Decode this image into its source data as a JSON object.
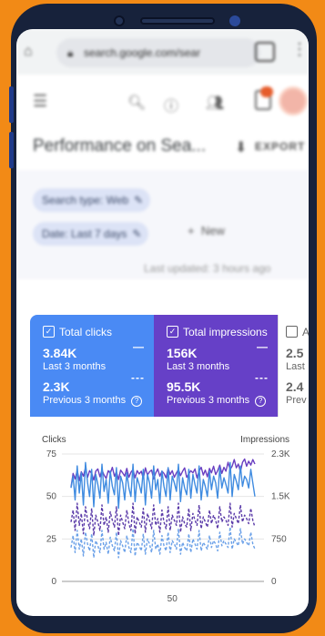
{
  "browser": {
    "url": "search.google.com/sear",
    "tab_count": ""
  },
  "page": {
    "title": "Performance on Sea...",
    "export_label": "EXPORT"
  },
  "filters": {
    "search_type": "Search type: Web",
    "date": "Date: Last 7 days",
    "new_label": "New",
    "last_updated": "Last updated: 3 hours ago"
  },
  "metrics": [
    {
      "label": "Total clicks",
      "current_value": "3.84K",
      "current_period": "Last 3 months",
      "previous_value": "2.3K",
      "previous_period": "Previous 3 months",
      "color": "#4a8af4"
    },
    {
      "label": "Total impressions",
      "current_value": "156K",
      "current_period": "Last 3 months",
      "previous_value": "95.5K",
      "previous_period": "Previous 3 months",
      "color": "#6640c7"
    },
    {
      "label": "A",
      "current_value": "2.5",
      "current_period": "Last",
      "previous_value": "2.4",
      "previous_period": "Prev"
    }
  ],
  "chart_data": {
    "type": "line",
    "ylabel_left": "Clicks",
    "ylabel_right": "Impressions",
    "y_left_ticks": [
      "75",
      "50",
      "25",
      "0"
    ],
    "y_right_ticks": [
      "2.3K",
      "1.5K",
      "750",
      "0"
    ],
    "ylim_left": [
      0,
      75
    ],
    "ylim_right": [
      0,
      2300
    ],
    "x_ticks": [
      "50"
    ],
    "xlim": [
      1,
      90
    ],
    "series": [
      {
        "axis": "right",
        "style": "solid",
        "color": "#6a3fc1",
        "values": [
          1700,
          1950,
          1850,
          2000,
          1820,
          1980,
          1900,
          2050,
          1880,
          2000,
          1950,
          1830,
          1990,
          2030,
          1890,
          2010,
          1920,
          1860,
          2000,
          1950,
          2060,
          1900,
          1980,
          1840,
          2010,
          1960,
          1900,
          2040,
          1880,
          1970,
          2020,
          1870,
          2000,
          1940,
          1990,
          1860,
          2050,
          1920,
          1980,
          2010,
          1850,
          1960,
          2030,
          1900,
          1990,
          1950,
          1870,
          2040,
          1930,
          2000,
          1880,
          1960,
          2020,
          1910,
          1990,
          2050,
          1880,
          1940,
          2000,
          1960,
          2030,
          1870,
          1990,
          2060,
          1920,
          2010,
          1890,
          2040,
          1960,
          2080,
          1930,
          2000,
          2100,
          1950,
          2060,
          1990,
          2150,
          2020,
          2080,
          2200,
          2050,
          2120,
          1980,
          2150,
          2210,
          2080,
          2170,
          2100,
          2200,
          2120
        ]
      },
      {
        "axis": "left",
        "style": "solid",
        "color": "#3f8be0",
        "values": [
          55,
          62,
          48,
          68,
          52,
          64,
          45,
          70,
          58,
          50,
          66,
          44,
          63,
          57,
          49,
          69,
          53,
          60,
          46,
          65,
          56,
          51,
          67,
          43,
          62,
          58,
          48,
          64,
          55,
          50,
          69,
          47,
          61,
          57,
          52,
          66,
          45,
          63,
          58,
          49,
          68,
          54,
          60,
          46,
          65,
          56,
          50,
          67,
          48,
          62,
          58,
          53,
          69,
          47,
          61,
          55,
          51,
          66,
          49,
          63,
          57,
          52,
          68,
          48,
          60,
          56,
          50,
          65,
          54,
          62,
          58,
          49,
          67,
          55,
          61,
          57,
          52,
          70,
          50,
          63,
          59,
          54,
          68,
          56,
          62,
          60,
          55,
          66,
          58,
          50
        ]
      },
      {
        "axis": "left",
        "style": "dashed",
        "color": "#5a3aa8",
        "values": [
          35,
          42,
          30,
          46,
          33,
          40,
          28,
          44,
          36,
          31,
          43,
          27,
          39,
          35,
          30,
          45,
          33,
          38,
          29,
          41,
          36,
          32,
          44,
          27,
          39,
          35,
          31,
          42,
          34,
          30,
          46,
          28,
          38,
          35,
          32,
          43,
          29,
          40,
          36,
          31,
          45,
          33,
          37,
          29,
          42,
          35,
          31,
          44,
          30,
          39,
          36,
          33,
          46,
          29,
          38,
          34,
          32,
          43,
          30,
          40,
          36,
          33,
          45,
          31,
          38,
          35,
          32,
          42,
          34,
          39,
          36,
          31,
          44,
          35,
          38,
          36,
          33,
          46,
          32,
          40,
          37,
          34,
          45,
          35,
          39,
          37,
          34,
          43,
          36,
          32
        ]
      },
      {
        "axis": "left",
        "style": "dashed",
        "color": "#6aa0e8",
        "values": [
          20,
          27,
          17,
          30,
          19,
          25,
          15,
          29,
          22,
          18,
          28,
          14,
          24,
          21,
          17,
          30,
          19,
          23,
          16,
          26,
          21,
          18,
          29,
          14,
          24,
          21,
          17,
          27,
          20,
          17,
          31,
          15,
          23,
          21,
          18,
          28,
          16,
          25,
          22,
          17,
          30,
          19,
          22,
          16,
          27,
          21,
          18,
          29,
          17,
          24,
          22,
          19,
          31,
          16,
          23,
          20,
          18,
          28,
          17,
          25,
          22,
          19,
          30,
          18,
          23,
          21,
          19,
          27,
          20,
          24,
          22,
          18,
          29,
          21,
          24,
          22,
          20,
          32,
          19,
          25,
          23,
          21,
          31,
          22,
          25,
          23,
          21,
          29,
          22,
          19
        ]
      }
    ]
  }
}
